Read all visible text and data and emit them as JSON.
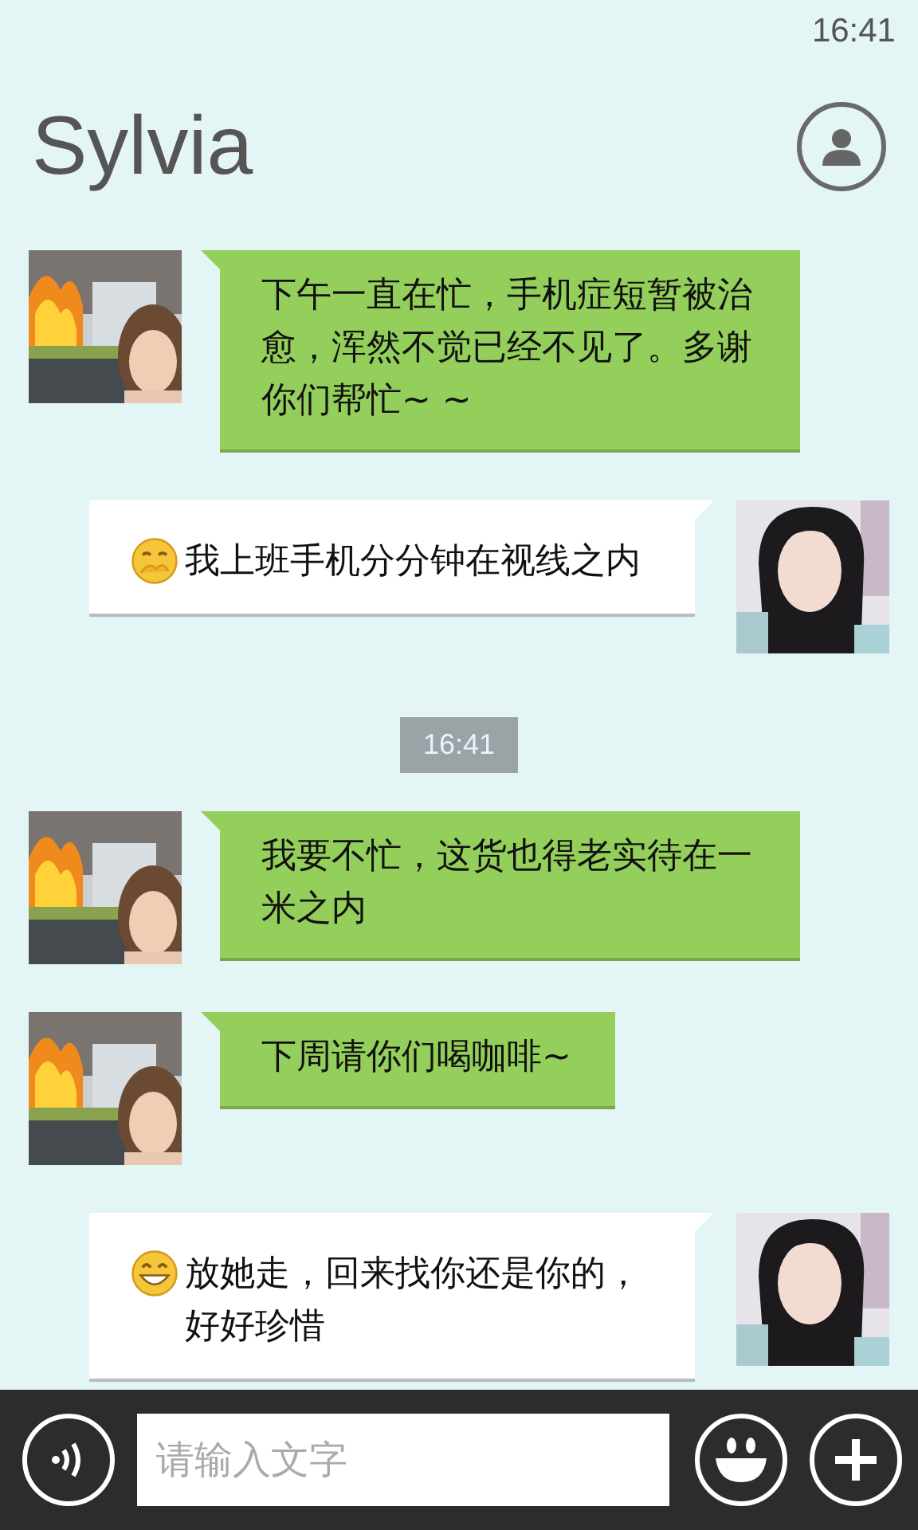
{
  "status_bar": {
    "time": "16:41"
  },
  "header": {
    "title": "Sylvia"
  },
  "messages": [
    {
      "kind": "incoming",
      "text": "下午一直在忙，手机症短暂被治愈，浑然不觉已经不见了。多谢你们帮忙~ ~"
    },
    {
      "kind": "outgoing",
      "emoji": {
        "kind": "hug"
      },
      "text": "我上班手机分分钟在视线之内"
    },
    {
      "kind": "timestamp",
      "text": "16:41"
    },
    {
      "kind": "incoming",
      "text": "我要不忙，这货也得老实待在一米之内"
    },
    {
      "kind": "incoming",
      "text": "下周请你们喝咖啡~"
    },
    {
      "kind": "outgoing",
      "emoji": {
        "kind": "grin"
      },
      "text": "放她走，回来找你还是你的，好好珍惜"
    }
  ],
  "composer": {
    "placeholder": "请输入文字"
  }
}
